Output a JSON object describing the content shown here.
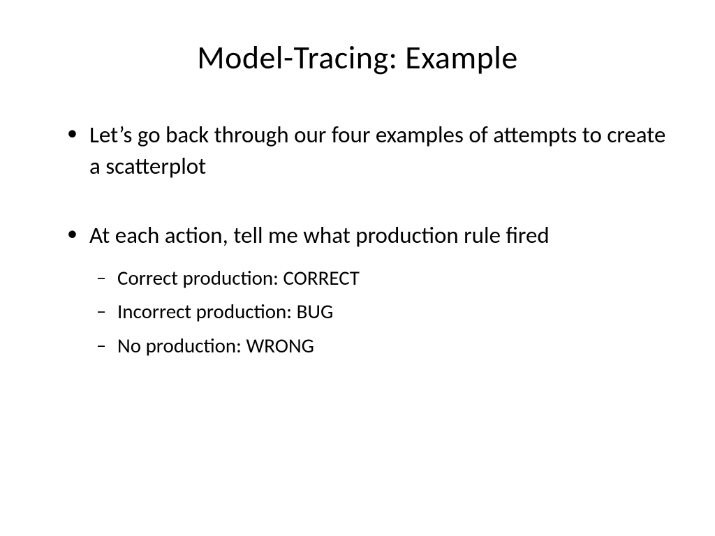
{
  "title": "Model-Tracing: Example",
  "bullets": [
    {
      "text": "Let’s go back through our four examples of attempts to create a scatterplot",
      "children": []
    },
    {
      "text": "At each action, tell me what production rule fired",
      "children": [
        {
          "text": "Correct production: CORRECT"
        },
        {
          "text": "Incorrect production: BUG"
        },
        {
          "text": "No production: WRONG"
        }
      ]
    }
  ]
}
